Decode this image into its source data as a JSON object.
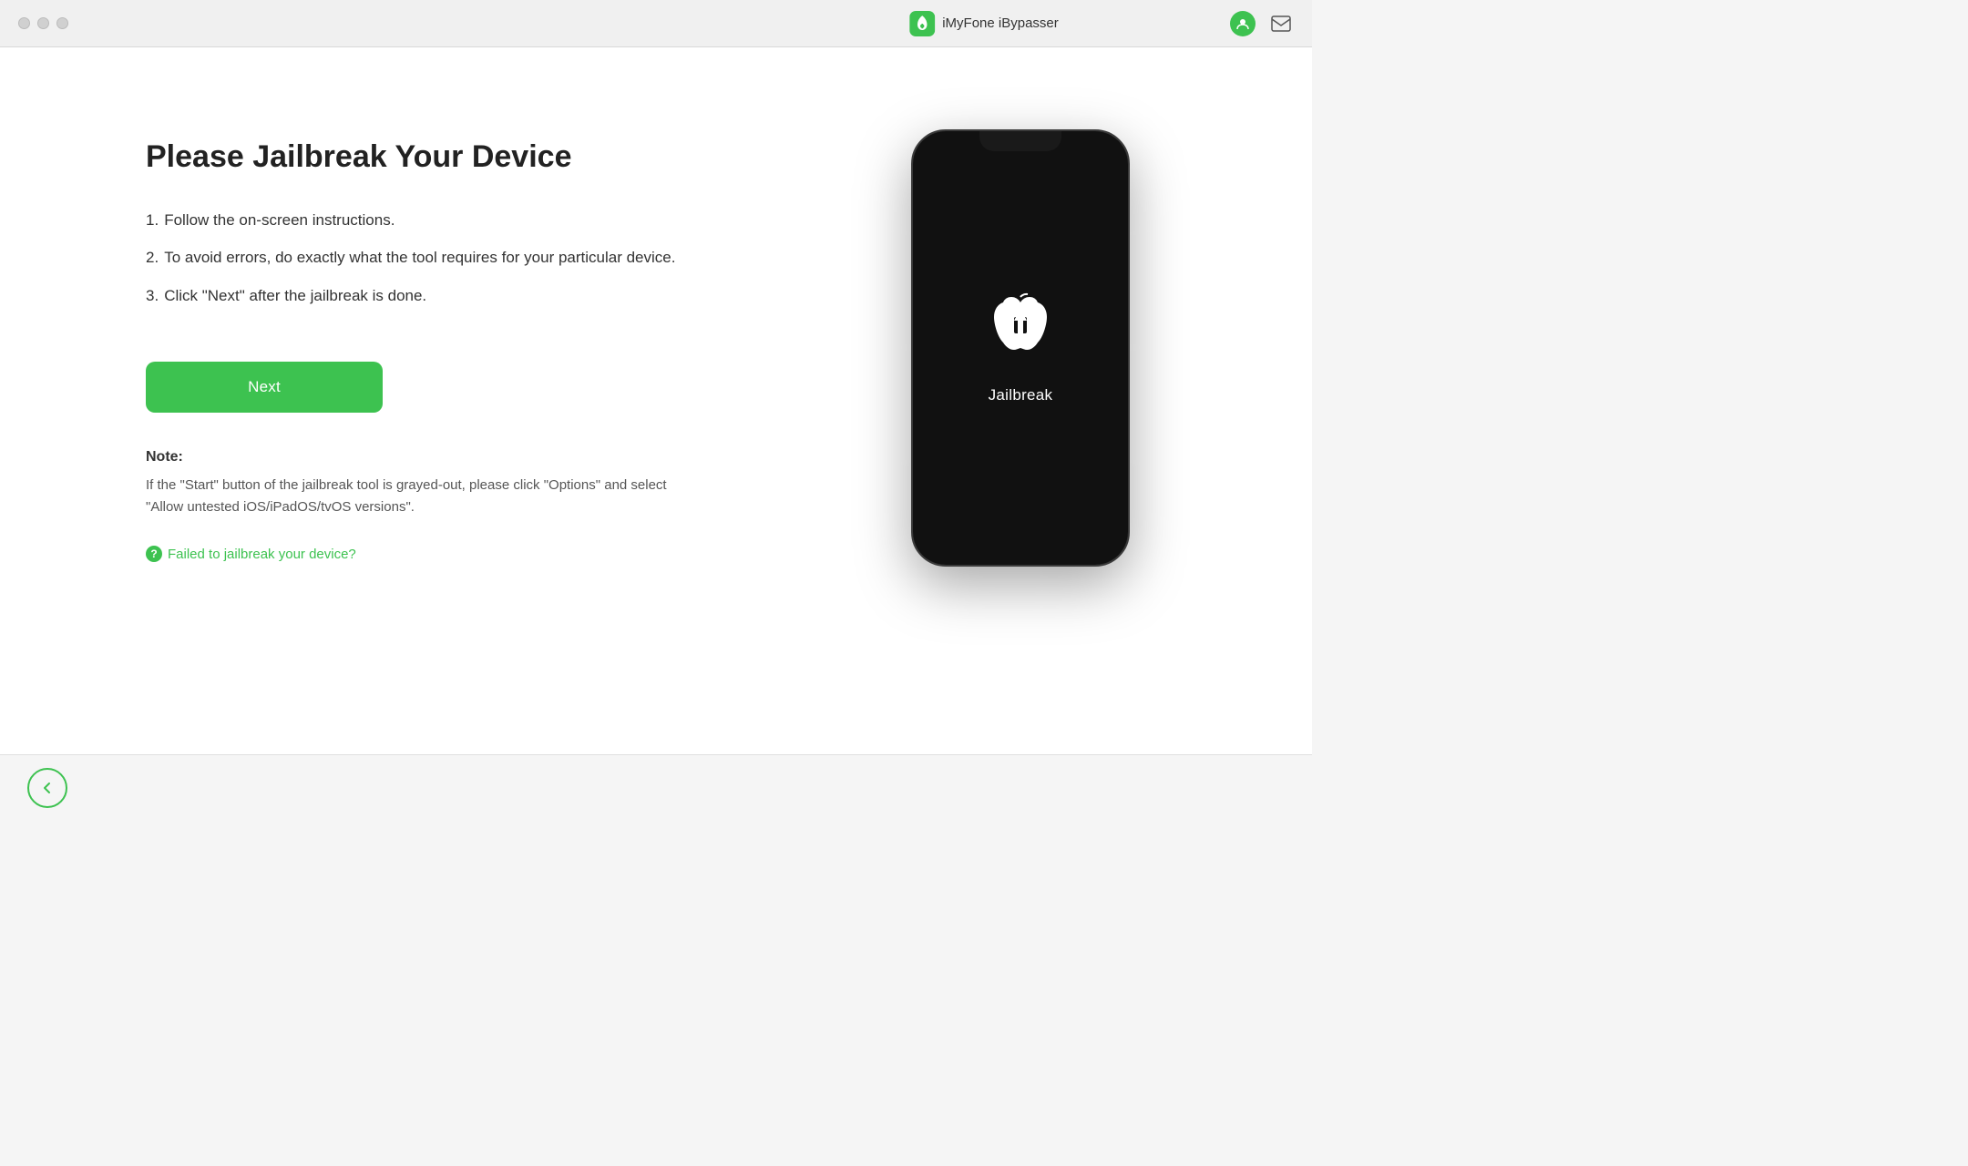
{
  "titlebar": {
    "app_name": "iMyFone iBypasser",
    "traffic_lights": [
      "close",
      "minimize",
      "maximize"
    ]
  },
  "main": {
    "page_title": "Please Jailbreak Your Device",
    "instructions": [
      {
        "number": "1.",
        "text": "Follow the on-screen instructions."
      },
      {
        "number": "2.",
        "text": "To avoid errors, do exactly what the tool requires for your particular device."
      },
      {
        "number": "3.",
        "text": "Click \"Next\" after the jailbreak is done."
      }
    ],
    "next_button_label": "Next",
    "note_label": "Note:",
    "note_text": "If the \"Start\" button of the jailbreak tool is grayed-out, please click \"Options\" and select \"Allow untested iOS/iPadOS/tvOS versions\".",
    "failed_link_text": "Failed to jailbreak your device?",
    "phone_label": "Jailbreak"
  },
  "bottom": {
    "back_button_label": "←"
  },
  "colors": {
    "green": "#3dc250",
    "dark_text": "#222222",
    "body_text": "#333333",
    "muted_text": "#555555"
  }
}
